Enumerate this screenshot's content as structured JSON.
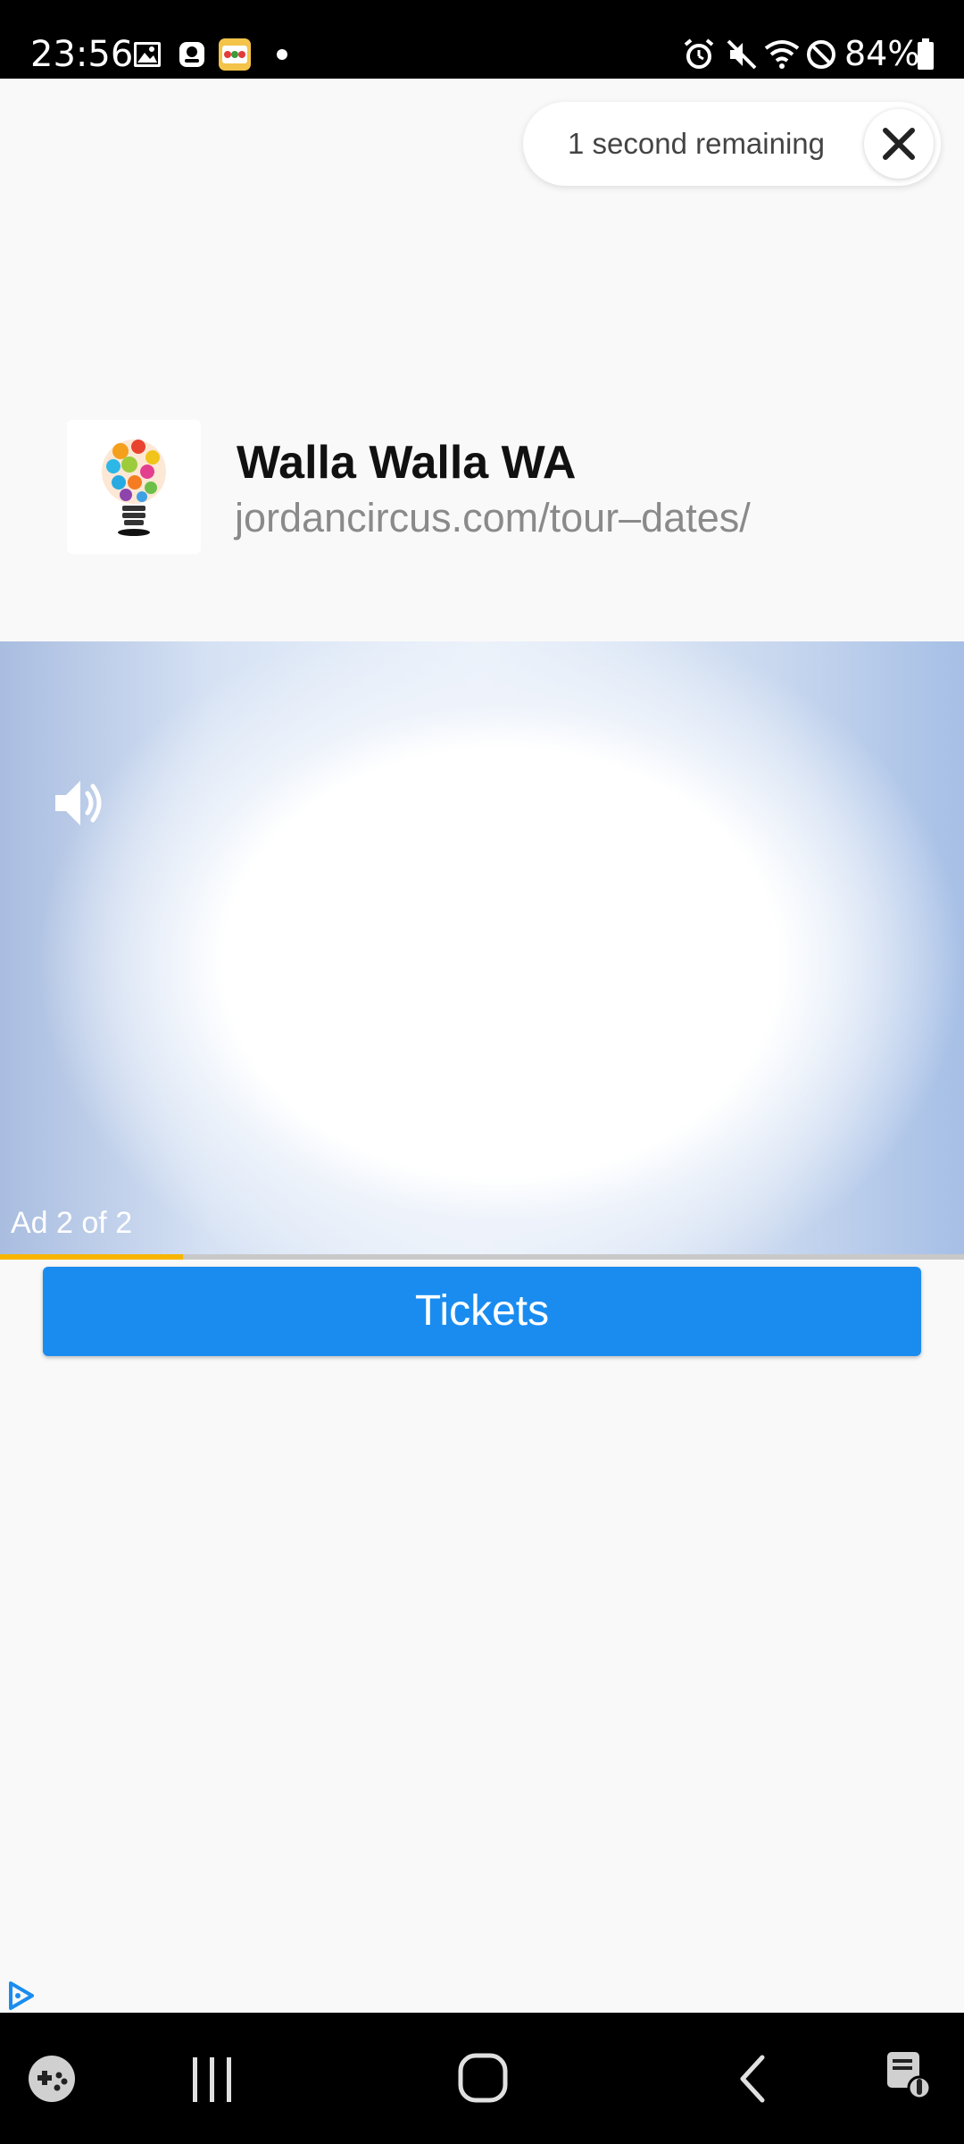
{
  "status_bar": {
    "time": "23:56",
    "battery_percent": "84%",
    "left_icons": [
      "image-icon",
      "app-notification-icon",
      "slots-app-icon",
      "dot-icon"
    ],
    "right_icons": [
      "alarm-icon",
      "mute-icon",
      "wifi-icon",
      "do-not-disturb-icon",
      "battery-icon"
    ]
  },
  "ad": {
    "countdown_text": "1 second remaining",
    "close_icon": "close-icon",
    "advertiser_title": "Walla Walla WA",
    "advertiser_url": "jordancircus.com/tour–dates/",
    "ad_counter": "Ad 2 of 2",
    "progress_fraction": 0.19,
    "cta_label": "Tickets",
    "colors": {
      "cta": "#1a8cf0",
      "progress": "#f7b500"
    }
  },
  "nav_bar": {
    "icons": [
      "game-launcher-icon",
      "recent-apps-icon",
      "home-icon",
      "back-icon",
      "assistant-icon"
    ]
  }
}
